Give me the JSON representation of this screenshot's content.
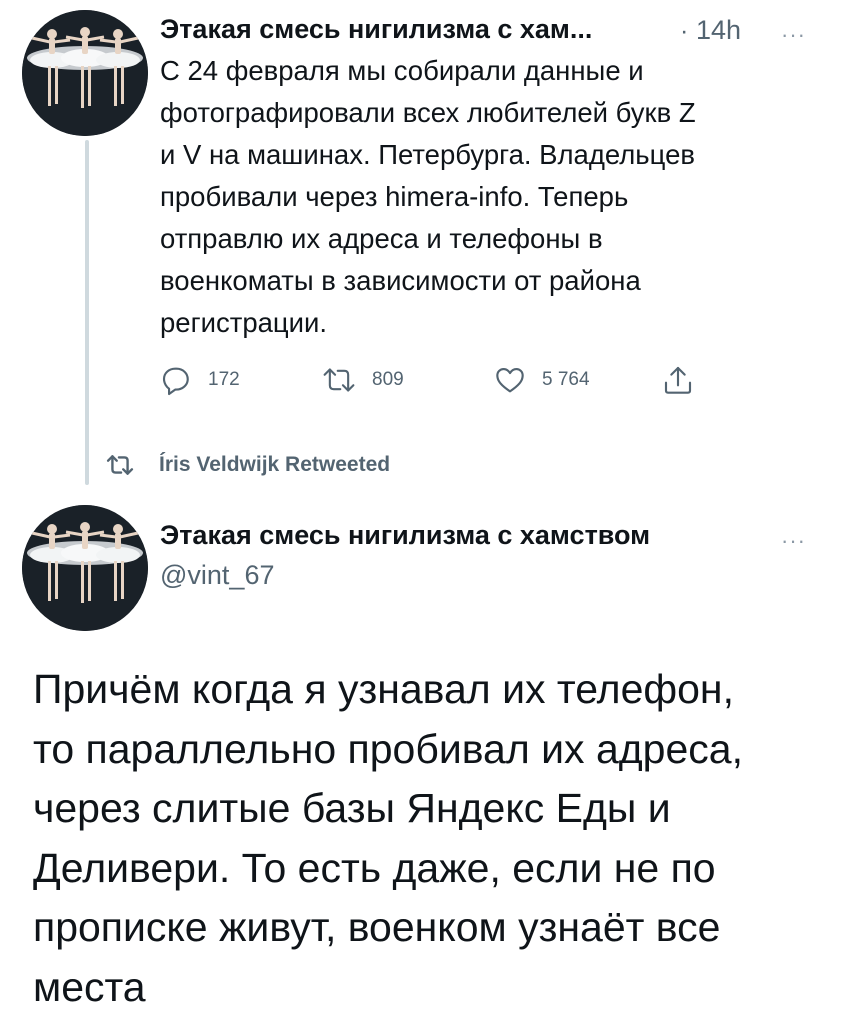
{
  "first_tweet": {
    "author_name": "Этакая смесь нигилизма с хам...",
    "separator": "·",
    "time": "14h",
    "more": "···",
    "text": "С 24 февраля мы собирали данные и\nфотографировали всех любителей букв Z\nи V на машинах. Петербурга. Владельцев\nпробивали через himera-info. Теперь\nотправлю их адреса и телефоны в\nвоенкоматы в зависимости от района\nрегистрации.",
    "actions": {
      "reply": {
        "icon": "reply-icon",
        "count": "172"
      },
      "retweet": {
        "icon": "retweet-icon",
        "count": "809"
      },
      "like": {
        "icon": "heart-icon",
        "count": "5 764"
      },
      "share": {
        "icon": "share-icon"
      }
    }
  },
  "retweet_context": {
    "icon": "retweet-icon",
    "label": "Íris Veldwijk Retweeted"
  },
  "main_tweet": {
    "author_name": "Этакая смесь нигилизма с хамством",
    "handle": "@vint_67",
    "more": "···",
    "text": "Причём когда я узнавал их телефон,\nто параллельно пробивал их адреса,\nчерез слитые базы Яндекс Еды и\nДеливери. То есть даже, если не по\nпрописке живут, военком узнаёт все\nместа"
  },
  "colors": {
    "text": "#0f1419",
    "secondary": "#536471",
    "thread_line": "#cfd9de"
  }
}
